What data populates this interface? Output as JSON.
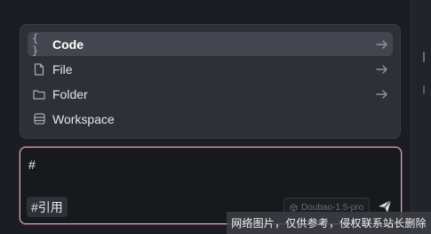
{
  "menu": {
    "items": [
      {
        "label": "Code",
        "icon": "code-braces-icon",
        "active": true
      },
      {
        "label": "File",
        "icon": "file-icon",
        "active": false
      },
      {
        "label": "Folder",
        "icon": "folder-icon",
        "active": false
      },
      {
        "label": "Workspace",
        "icon": "workspace-icon",
        "active": false
      }
    ]
  },
  "composer": {
    "text": "#",
    "reference_chip": "#引用",
    "model": "Doubao-1.5-pro"
  },
  "watermark": "网络图片，仅供参考，侵权联系站长删除",
  "colors": {
    "menu_bg": "#2e3037",
    "active_row": "#43464f",
    "composer_border": "#c9b4c8",
    "page_bg": "#1c1d22"
  }
}
